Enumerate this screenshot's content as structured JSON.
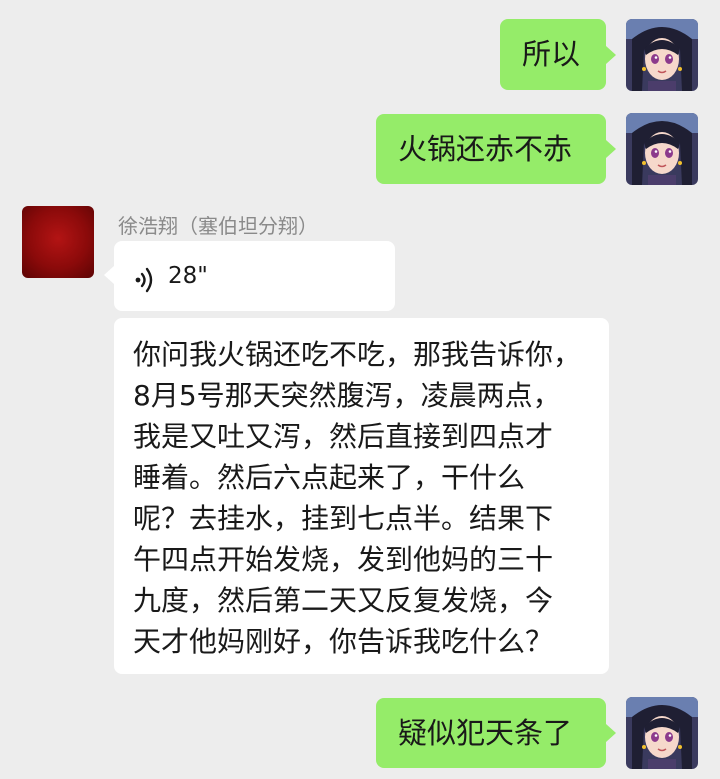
{
  "chat": {
    "messages": [
      {
        "direction": "out",
        "type": "text",
        "text": "所以"
      },
      {
        "direction": "out",
        "type": "text",
        "text": "火锅还赤不赤"
      },
      {
        "direction": "in",
        "type": "sender",
        "text": "徐浩翔（塞伯坦分翔）"
      },
      {
        "direction": "in",
        "type": "voice",
        "duration": "28\"",
        "icon": "voice-wave-icon"
      },
      {
        "direction": "in",
        "type": "text",
        "lines": [
          "你问我火锅还吃不吃，那我告诉你，",
          "8月5号那天突然腹泻，凌晨两点，",
          "我是又吐又泻，然后直接到四点才",
          "睡着。然后六点起来了，干什么",
          "呢？去挂水，挂到七点半。结果下",
          "午四点开始发烧，发到他妈的三十",
          "九度，然后第二天又反复发烧，今",
          "天才他妈刚好，你告诉我吃什么？"
        ]
      },
      {
        "direction": "out",
        "type": "text",
        "text": "疑似犯天条了"
      }
    ]
  },
  "colors": {
    "background": "#ededed",
    "outgoing_bubble": "#95ec69",
    "incoming_bubble": "#ffffff",
    "sender_avatar": "#8b0a0a"
  }
}
